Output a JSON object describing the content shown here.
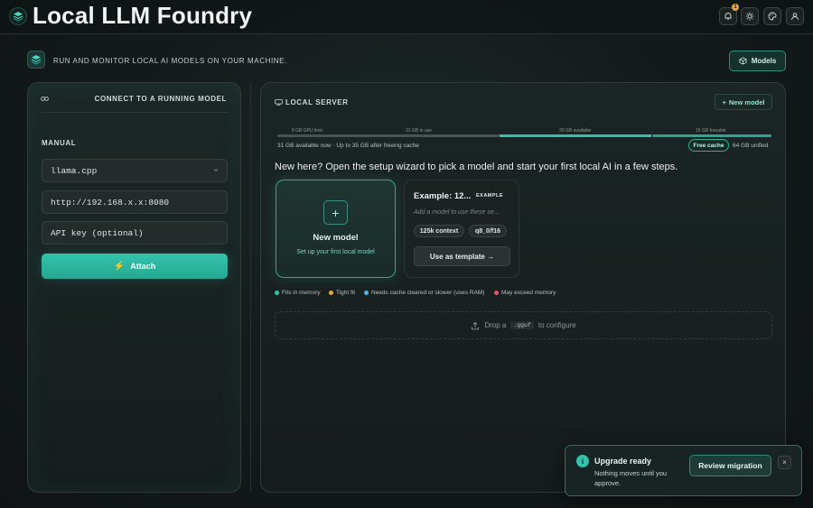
{
  "header": {
    "title": "Local LLM Foundry",
    "notification_count": "1",
    "icons": [
      "logo-layers-icon",
      "bell-icon",
      "sun-icon",
      "palette-icon",
      "user-icon"
    ]
  },
  "subheader": {
    "tagline": "RUN AND MONITOR LOCAL AI MODELS ON YOUR MACHINE.",
    "models_button": "Models"
  },
  "connect_panel": {
    "title": "CONNECT TO A RUNNING MODEL",
    "section_label": "MANUAL",
    "runtime_select": "llama.cpp",
    "url_value": "http://192.168.x.x:8080",
    "api_key_placeholder": "API key (optional)",
    "attach_button": "Attach"
  },
  "server_panel": {
    "title": "LOCAL SERVER",
    "new_model_button": "New model",
    "memory": {
      "labels": [
        "8 GB GPU limit",
        "21 GB in use",
        "20 GB available",
        "15 GB freeable"
      ],
      "summary": "31 GB available now · Up to 35 GB after freeing cache",
      "free_cache_button": "Free cache",
      "unified": "64 GB unified"
    },
    "intro": "New here? Open the setup wizard to pick a model and start your first local AI in a few steps.",
    "new_model_card": {
      "title": "New model",
      "subtitle": "Set up your first local model"
    },
    "example_card": {
      "title": "Example: 12...",
      "badge": "EXAMPLE",
      "description": "Add a model to use these se...",
      "chips": [
        "125k context",
        "q8_0/f16"
      ],
      "button": "Use as template →"
    },
    "legend": [
      {
        "label": "Fits in memory",
        "color": "#2fc3aa"
      },
      {
        "label": "Tight fit",
        "color": "#e8a64a"
      },
      {
        "label": "Needs cache cleared or slower (uses RAM)",
        "color": "#4fb7e3"
      },
      {
        "label": "May exceed memory",
        "color": "#e0566b"
      }
    ],
    "dropzone": {
      "prefix": "Drop a",
      "code": ".gguf",
      "suffix": "to configure"
    }
  },
  "toast": {
    "title": "Upgrade ready",
    "body": "Nothing moves until you approve.",
    "button": "Review migration",
    "close": "×"
  }
}
